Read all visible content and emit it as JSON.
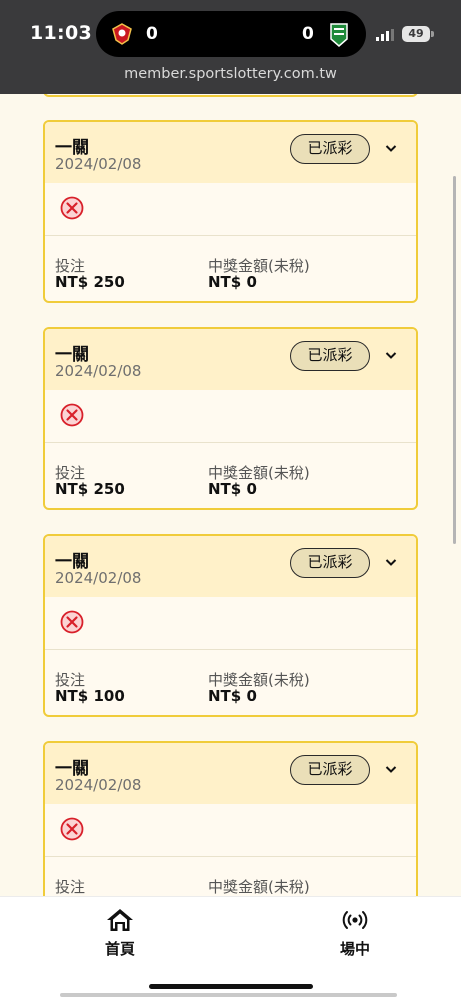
{
  "status_bar": {
    "time": "11:03",
    "home_score": "0",
    "away_score": "0",
    "battery": "49"
  },
  "browser": {
    "url": "member.sportslottery.com.tw"
  },
  "colors": {
    "card_border": "#f0cc3a",
    "card_header": "#fff1c9",
    "status_pill": "#eadfb8",
    "lose_icon": "#d8202a"
  },
  "bets": [
    {
      "type": "一關",
      "date": "2024/02/08",
      "status": "已派彩",
      "result_icon": "lose-x-icon",
      "stake_label": "投注",
      "stake": "NT$ 250",
      "payout_label": "中獎金額(未稅)",
      "payout": "NT$ 0"
    },
    {
      "type": "一關",
      "date": "2024/02/08",
      "status": "已派彩",
      "result_icon": "lose-x-icon",
      "stake_label": "投注",
      "stake": "NT$ 250",
      "payout_label": "中獎金額(未稅)",
      "payout": "NT$ 0"
    },
    {
      "type": "一關",
      "date": "2024/02/08",
      "status": "已派彩",
      "result_icon": "lose-x-icon",
      "stake_label": "投注",
      "stake": "NT$ 100",
      "payout_label": "中獎金額(未稅)",
      "payout": "NT$ 0"
    },
    {
      "type": "一關",
      "date": "2024/02/08",
      "status": "已派彩",
      "result_icon": "lose-x-icon",
      "stake_label": "投注",
      "stake": "",
      "payout_label": "中獎金額(未稅)",
      "payout": ""
    }
  ],
  "nav": {
    "home": {
      "label": "首頁",
      "icon": "home-icon"
    },
    "live": {
      "label": "場中",
      "icon": "live-broadcast-icon"
    }
  }
}
